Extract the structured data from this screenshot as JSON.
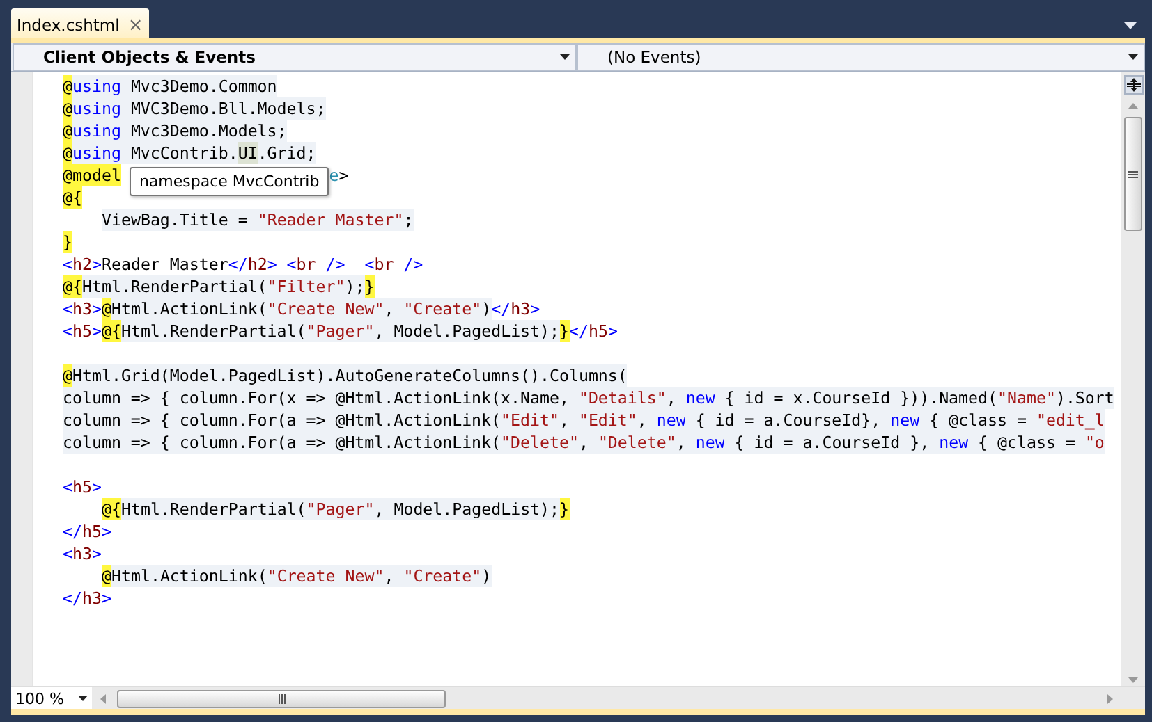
{
  "tab": {
    "title": "Index.cshtml",
    "close": "×",
    "selected": true
  },
  "navigation": {
    "objects": "Client Objects & Events",
    "events": "(No Events)"
  },
  "lines": [
    {
      "tokens": [
        {
          "text": "@",
          "kind": "razor"
        },
        {
          "text": "using",
          "kind": "keyword",
          "shaded": true
        },
        {
          "text": " Mvc3Demo.Common",
          "kind": "plain",
          "shaded": true
        }
      ]
    },
    {
      "tokens": [
        {
          "text": "@",
          "kind": "razor"
        },
        {
          "text": "using",
          "kind": "keyword",
          "shaded": true
        },
        {
          "text": " MVC3Demo.Bll.Models;",
          "kind": "plain",
          "shaded": true
        }
      ]
    },
    {
      "tokens": [
        {
          "text": "@",
          "kind": "razor"
        },
        {
          "text": "using",
          "kind": "keyword",
          "shaded": true
        },
        {
          "text": " Mvc3Demo.Models;",
          "kind": "plain",
          "shaded": true
        }
      ]
    },
    {
      "tokens": [
        {
          "text": "@",
          "kind": "razor"
        },
        {
          "text": "using",
          "kind": "keyword",
          "shaded": true
        },
        {
          "text": " MvcContrib.",
          "kind": "plain",
          "shaded": true
        },
        {
          "text": "UI",
          "kind": "match"
        },
        {
          "text": ".Grid;",
          "kind": "plain",
          "shaded": true
        }
      ]
    },
    {
      "tooltip": "namespace MvcContrib",
      "tokens": [
        {
          "text": "@model",
          "kind": "razor"
        },
        {
          "text": "e",
          "kind": "type",
          "shaded": false
        },
        {
          "text": ">",
          "kind": "plain",
          "shaded": false
        }
      ]
    },
    {
      "tokens": [
        {
          "text": "@{",
          "kind": "razor"
        }
      ],
      "children": [
        {
          "tokens": [
            {
              "text": "ViewBag.Title = ",
              "kind": "plain",
              "shaded": true
            },
            {
              "text": "\"Reader Master\"",
              "kind": "string",
              "shaded": true
            },
            {
              "text": ";",
              "kind": "plain",
              "shaded": true
            }
          ]
        }
      ]
    },
    {
      "tokens": [
        {
          "text": "}",
          "kind": "razor"
        }
      ]
    },
    {
      "tokens": [
        {
          "text": "<",
          "kind": "tag",
          "shaded": false
        },
        {
          "text": "h2",
          "kind": "tagname",
          "shaded": false
        },
        {
          "text": ">",
          "kind": "tag",
          "shaded": false
        },
        {
          "text": "Reader Master",
          "kind": "plain",
          "shaded": false
        },
        {
          "text": "</",
          "kind": "tag",
          "shaded": false
        },
        {
          "text": "h2",
          "kind": "tagname",
          "shaded": false
        },
        {
          "text": "> <",
          "kind": "tag",
          "shaded": false
        },
        {
          "text": "br",
          "kind": "tagname",
          "shaded": false
        },
        {
          "text": " />  <",
          "kind": "tag",
          "shaded": false
        },
        {
          "text": "br",
          "kind": "tagname",
          "shaded": false
        },
        {
          "text": " />",
          "kind": "tag",
          "shaded": false
        }
      ]
    },
    {
      "tokens": [
        {
          "text": "@{",
          "kind": "razor"
        },
        {
          "text": "Html.RenderPartial(",
          "kind": "plain",
          "shaded": true
        },
        {
          "text": "\"Filter\"",
          "kind": "string",
          "shaded": true
        },
        {
          "text": ");",
          "kind": "plain",
          "shaded": true
        },
        {
          "text": "}",
          "kind": "razor"
        }
      ]
    },
    {
      "tokens": [
        {
          "text": "<",
          "kind": "tag",
          "shaded": false
        },
        {
          "text": "h3",
          "kind": "tagname",
          "shaded": false
        },
        {
          "text": ">",
          "kind": "tag",
          "shaded": false
        },
        {
          "text": "@",
          "kind": "razor"
        },
        {
          "text": "Html.ActionLink(",
          "kind": "plain",
          "shaded": true
        },
        {
          "text": "\"Create New\"",
          "kind": "string",
          "shaded": true
        },
        {
          "text": ", ",
          "kind": "plain",
          "shaded": true
        },
        {
          "text": "\"Create\"",
          "kind": "string",
          "shaded": true
        },
        {
          "text": ")",
          "kind": "plain",
          "shaded": true
        },
        {
          "text": "</",
          "kind": "tag",
          "shaded": false
        },
        {
          "text": "h3",
          "kind": "tagname",
          "shaded": false
        },
        {
          "text": ">",
          "kind": "tag",
          "shaded": false
        }
      ]
    },
    {
      "tokens": [
        {
          "text": "<",
          "kind": "tag",
          "shaded": false
        },
        {
          "text": "h5",
          "kind": "tagname",
          "shaded": false
        },
        {
          "text": ">",
          "kind": "tag",
          "shaded": false
        },
        {
          "text": "@{",
          "kind": "razor"
        },
        {
          "text": "Html.RenderPartial(",
          "kind": "plain",
          "shaded": true
        },
        {
          "text": "\"Pager\"",
          "kind": "string",
          "shaded": true
        },
        {
          "text": ", Model.PagedList);",
          "kind": "plain",
          "shaded": true
        },
        {
          "text": "}",
          "kind": "razor"
        },
        {
          "text": "</",
          "kind": "tag",
          "shaded": false
        },
        {
          "text": "h5",
          "kind": "tagname",
          "shaded": false
        },
        {
          "text": ">",
          "kind": "tag",
          "shaded": false
        }
      ]
    },
    {
      "blank_line_before": true,
      "tokens": [
        {
          "text": "@",
          "kind": "razor"
        },
        {
          "text": "Html.Grid(Model.PagedList).AutoGenerateColumns().Columns(",
          "kind": "plain",
          "shaded": true
        }
      ]
    },
    {
      "tokens": [
        {
          "text": "column => { column.For(x => @Html.ActionLink(x.Name, ",
          "kind": "plain",
          "shaded": true
        },
        {
          "text": "\"Details\"",
          "kind": "string",
          "shaded": true
        },
        {
          "text": ", ",
          "kind": "plain",
          "shaded": true
        },
        {
          "text": "new",
          "kind": "keyword",
          "shaded": true
        },
        {
          "text": " { id = x.CourseId })).Named(",
          "kind": "plain",
          "shaded": true
        },
        {
          "text": "\"Name\"",
          "kind": "string",
          "shaded": true
        },
        {
          "text": ").Sort",
          "kind": "plain",
          "shaded": true
        }
      ]
    },
    {
      "tokens": [
        {
          "text": "column => { column.For(a => @Html.ActionLink(",
          "kind": "plain",
          "shaded": true
        },
        {
          "text": "\"Edit\"",
          "kind": "string",
          "shaded": true
        },
        {
          "text": ", ",
          "kind": "plain",
          "shaded": true
        },
        {
          "text": "\"Edit\"",
          "kind": "string",
          "shaded": true
        },
        {
          "text": ", ",
          "kind": "plain",
          "shaded": true
        },
        {
          "text": "new",
          "kind": "keyword",
          "shaded": true
        },
        {
          "text": " { id = a.CourseId}, ",
          "kind": "plain",
          "shaded": true
        },
        {
          "text": "new",
          "kind": "keyword",
          "shaded": true
        },
        {
          "text": " { @class = ",
          "kind": "plain",
          "shaded": true
        },
        {
          "text": "\"edit_l",
          "kind": "string",
          "shaded": true
        }
      ]
    },
    {
      "tokens": [
        {
          "text": "column => { column.For(a => @Html.ActionLink(",
          "kind": "plain",
          "shaded": true
        },
        {
          "text": "\"Delete\"",
          "kind": "string",
          "shaded": true
        },
        {
          "text": ", ",
          "kind": "plain",
          "shaded": true
        },
        {
          "text": "\"Delete\"",
          "kind": "string",
          "shaded": true
        },
        {
          "text": ", ",
          "kind": "plain",
          "shaded": true
        },
        {
          "text": "new",
          "kind": "keyword",
          "shaded": true
        },
        {
          "text": " { id = a.CourseId }, ",
          "kind": "plain",
          "shaded": true
        },
        {
          "text": "new",
          "kind": "keyword",
          "shaded": true
        },
        {
          "text": " { @class = ",
          "kind": "plain",
          "shaded": true
        },
        {
          "text": "\"o",
          "kind": "string",
          "shaded": true
        }
      ]
    },
    {
      "blank_line_before": true,
      "tokens": [
        {
          "text": "<",
          "kind": "tag",
          "shaded": false
        },
        {
          "text": "h5",
          "kind": "tagname",
          "shaded": false
        },
        {
          "text": ">",
          "kind": "tag",
          "shaded": false
        }
      ],
      "children": [
        {
          "tokens": [
            {
              "text": "@{",
              "kind": "razor"
            },
            {
              "text": "Html.RenderPartial(",
              "kind": "plain",
              "shaded": true
            },
            {
              "text": "\"Pager\"",
              "kind": "string",
              "shaded": true
            },
            {
              "text": ", Model.PagedList);",
              "kind": "plain",
              "shaded": true
            },
            {
              "text": "}",
              "kind": "razor"
            }
          ]
        }
      ]
    },
    {
      "tokens": [
        {
          "text": "</",
          "kind": "tag",
          "shaded": false
        },
        {
          "text": "h5",
          "kind": "tagname",
          "shaded": false
        },
        {
          "text": ">",
          "kind": "tag",
          "shaded": false
        }
      ]
    },
    {
      "tokens": [
        {
          "text": "<",
          "kind": "tag",
          "shaded": false
        },
        {
          "text": "h3",
          "kind": "tagname",
          "shaded": false
        },
        {
          "text": ">",
          "kind": "tag",
          "shaded": false
        }
      ],
      "children": [
        {
          "tokens": [
            {
              "text": "@",
              "kind": "razor"
            },
            {
              "text": "Html.ActionLink(",
              "kind": "plain",
              "shaded": true
            },
            {
              "text": "\"Create New\"",
              "kind": "string",
              "shaded": true
            },
            {
              "text": ", ",
              "kind": "plain",
              "shaded": true
            },
            {
              "text": "\"Create\"",
              "kind": "string",
              "shaded": true
            },
            {
              "text": ")",
              "kind": "plain",
              "shaded": true
            }
          ]
        }
      ]
    },
    {
      "tokens": [
        {
          "text": "</",
          "kind": "tag",
          "shaded": false
        },
        {
          "text": "h3",
          "kind": "tagname",
          "shaded": false
        },
        {
          "text": ">",
          "kind": "tag",
          "shaded": false
        }
      ]
    }
  ],
  "zoom": {
    "value": "100 %"
  }
}
